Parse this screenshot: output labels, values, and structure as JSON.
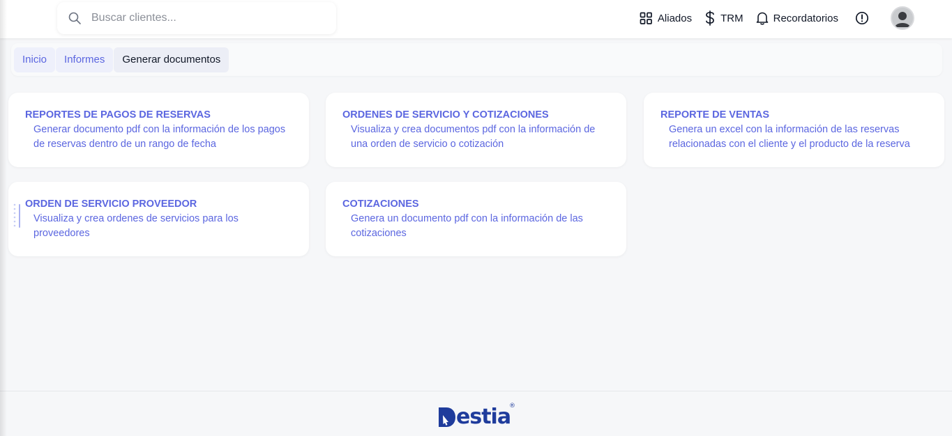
{
  "search": {
    "placeholder": "Buscar clientes..."
  },
  "topnav": {
    "aliados": "Aliados",
    "trm": "TRM",
    "recordatorios": "Recordatorios"
  },
  "breadcrumb": [
    {
      "label": "Inicio"
    },
    {
      "label": "Informes"
    },
    {
      "label": "Generar documentos"
    }
  ],
  "cards": [
    {
      "title": "REPORTES DE PAGOS DE RESERVAS",
      "description": "Generar documento pdf con la información de los pagos de reservas dentro de un rango de fecha"
    },
    {
      "title": "ORDENES DE SERVICIO Y COTIZACIONES",
      "description": "Visualiza y crea documentos pdf con la información de una orden de servicio o cotización"
    },
    {
      "title": "REPORTE DE VENTAS",
      "description": "Genera un excel con la información de las reservas relacionadas con el cliente y el producto de la reserva"
    },
    {
      "title": "ORDEN DE SERVICIO PROVEEDOR",
      "description": "Visualiza y crea ordenes de servicios para los proveedores"
    },
    {
      "title": "COTIZACIONES",
      "description": "Genera un documento pdf con la información de las cotizaciones"
    }
  ],
  "footer": {
    "logo_prefix": "D",
    "logo_main": "est",
    "logo_suffix": "ia",
    "logo_reg": "®"
  },
  "colors": {
    "accent": "#5b66e0",
    "brand": "#1f3c9c",
    "background": "#f6f7f9"
  }
}
